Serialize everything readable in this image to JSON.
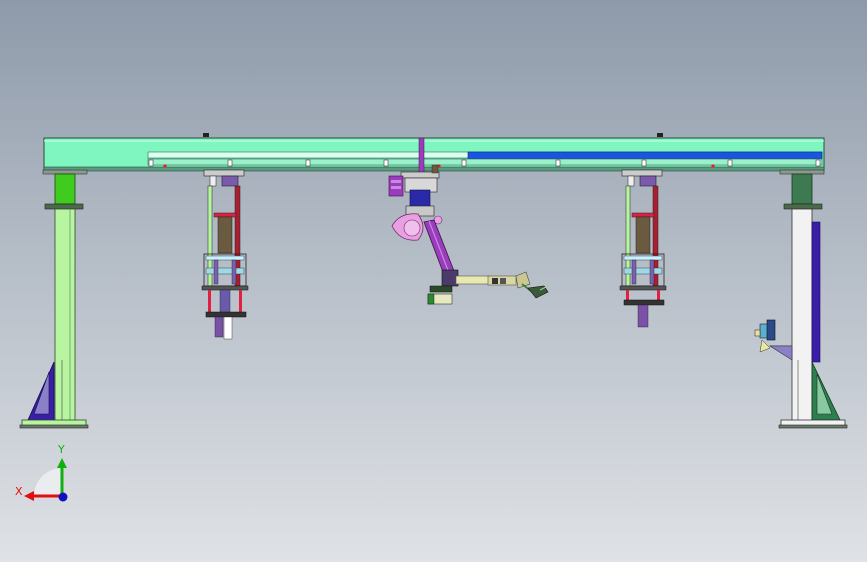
{
  "triad": {
    "x_label": "X",
    "y_label": "Y",
    "x_color": "#e01010",
    "y_color": "#10b010",
    "z_color": "#1010c0"
  },
  "colors": {
    "beam": "#7ff5c0",
    "rail": "#1a55e0",
    "column": "#b8f5a0",
    "column_light": "#f2f2f2",
    "brace": "#3a1ea8",
    "brace_right": "#2e7e50",
    "cap_left": "#3fcc1f",
    "cap_right": "#3d7a52",
    "arm": "#9a3dbd",
    "arm_pink": "#e8a0e0",
    "gripper": "#c8c890"
  }
}
